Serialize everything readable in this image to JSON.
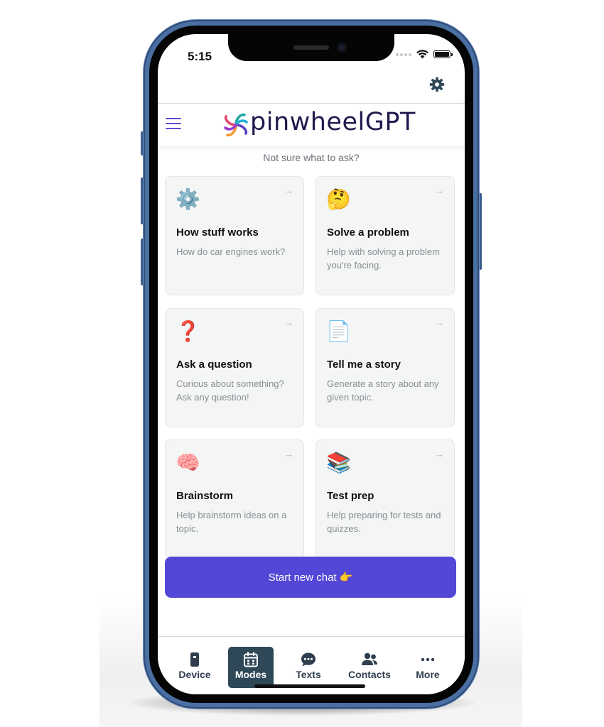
{
  "status_bar": {
    "time": "5:15"
  },
  "app": {
    "brand_name": "pinwheelGPT"
  },
  "prompt_hint": "Not sure what to ask?",
  "cards": [
    {
      "icon": "⚙️",
      "icon_name": "gear-icon",
      "title": "How stuff works",
      "description": "How do car engines work?"
    },
    {
      "icon": "🤔",
      "icon_name": "thinking-face-icon",
      "title": "Solve a problem",
      "description": "Help with solving a problem you're facing."
    },
    {
      "icon": "❓",
      "icon_name": "question-mark-icon",
      "title": "Ask a question",
      "description": "Curious about something? Ask any question!"
    },
    {
      "icon": "📄",
      "icon_name": "page-icon",
      "title": "Tell me a story",
      "description": "Generate a story about any given topic."
    },
    {
      "icon": "🧠",
      "icon_name": "brain-icon",
      "title": "Brainstorm",
      "description": "Help brainstorm ideas on a topic."
    },
    {
      "icon": "📚",
      "icon_name": "books-icon",
      "title": "Test prep",
      "description": "Help preparing for tests and quizzes."
    }
  ],
  "card_arrow": "→",
  "start_chat": {
    "label": "Start new chat",
    "emoji": "👉"
  },
  "tabs": [
    {
      "label": "Device",
      "icon_name": "device-icon",
      "active": false
    },
    {
      "label": "Modes",
      "icon_name": "calendar-icon",
      "active": true
    },
    {
      "label": "Texts",
      "icon_name": "chat-bubble-icon",
      "active": false
    },
    {
      "label": "Contacts",
      "icon_name": "contacts-icon",
      "active": false
    },
    {
      "label": "More",
      "icon_name": "more-dots-icon",
      "active": false
    }
  ],
  "colors": {
    "accent": "#5247d6",
    "tab_active_bg": "#2f4858",
    "phone_frame": "#4a6fa2"
  }
}
